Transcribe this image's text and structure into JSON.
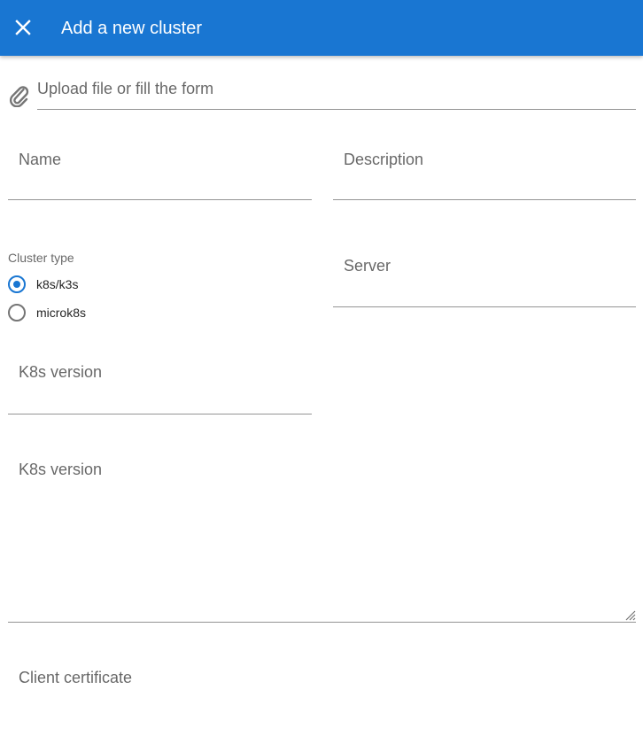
{
  "header": {
    "title": "Add a new cluster",
    "close_icon": "close-icon",
    "color": "#1976d2"
  },
  "upload": {
    "label": "Upload file or fill the form",
    "icon": "paperclip-icon"
  },
  "form": {
    "name_label": "Name",
    "description_label": "Description",
    "cluster_type": {
      "label": "Cluster type",
      "options": [
        {
          "label": "k8s/k3s",
          "selected": true
        },
        {
          "label": "microk8s",
          "selected": false
        }
      ]
    },
    "server_label": "Server",
    "k8s_version_label": "K8s version",
    "k8s_version_textarea_label": "K8s version",
    "client_certificate_label": "Client certificate"
  }
}
